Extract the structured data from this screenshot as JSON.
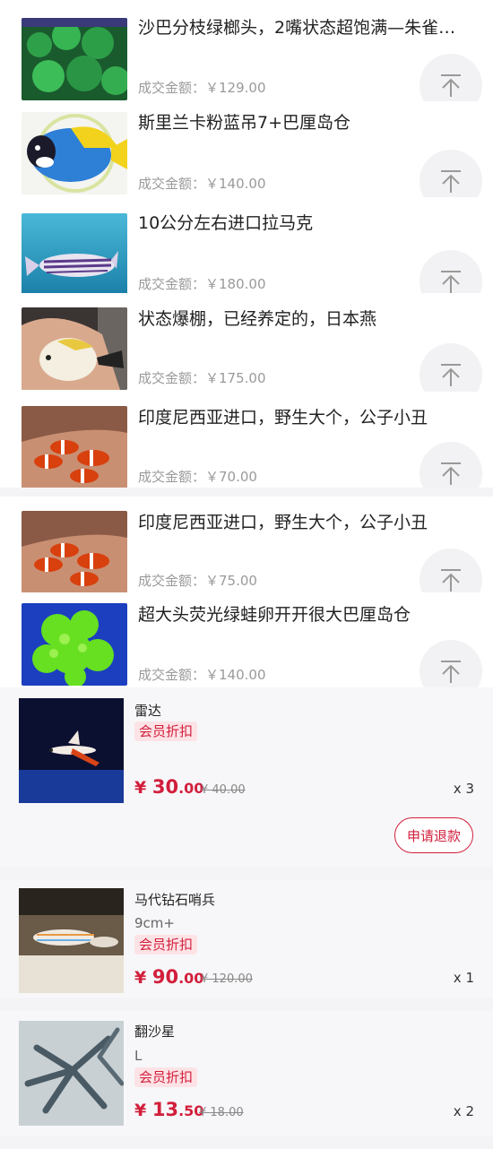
{
  "deals": [
    {
      "title": "沙巴分枝绿榔头，2嘴状态超饱满—朱雀…",
      "amount": "成交金额：￥129.00",
      "thumb": "green-coral-photo"
    },
    {
      "title": "斯里兰卡粉蓝吊7+巴厘岛仓",
      "amount": "成交金额：￥140.00",
      "thumb": "blue-tang-photo"
    },
    {
      "title": "10公分左右进口拉马克",
      "amount": "成交金额：￥180.00",
      "thumb": "striped-fish-photo"
    },
    {
      "title": "状态爆棚，已经养定的，日本燕",
      "amount": "成交金额：￥175.00",
      "thumb": "angelfish-in-hand-photo"
    },
    {
      "title": "印度尼西亚进口，野生大个，公子小丑",
      "amount": "成交金额：￥70.00",
      "thumb": "clownfish-in-hand-photo"
    },
    {
      "title": "印度尼西亚进口，野生大个，公子小丑",
      "amount": "成交金额：￥75.00",
      "thumb": "clownfish-in-hand-photo"
    },
    {
      "title": "超大头荧光绿蛙卵开开很大巴厘岛仓",
      "amount": "成交金额：￥140.00",
      "thumb": "fluorescent-coral-photo"
    }
  ],
  "back_to_top_icon": "arrow-up-bar-icon",
  "orders": [
    {
      "name": "雷达",
      "spec": "",
      "badge": "会员折扣",
      "currency": "¥ ",
      "price_int": "30",
      "price_dec": ".00",
      "original": "¥ 40.00",
      "qty": "x 3",
      "refund_label": "申请退款",
      "image": "firefish-photo"
    },
    {
      "name": "马代钻石哨兵",
      "spec": "9cm+",
      "badge": "会员折扣",
      "currency": "¥ ",
      "price_int": "90",
      "price_dec": ".00",
      "original": "¥ 120.00",
      "qty": "x 1",
      "image": "goby-photo"
    },
    {
      "name": "翻沙星",
      "spec": "L",
      "badge": "会员折扣",
      "currency": "¥ ",
      "price_int": "13",
      "price_dec": ".50",
      "original": "¥ 18.00",
      "qty": "x 2",
      "image": "starfish-photo"
    }
  ],
  "colors": {
    "accent": "#d21f3c",
    "badge_bg": "#fde3e6",
    "muted": "#9a9a9a"
  }
}
